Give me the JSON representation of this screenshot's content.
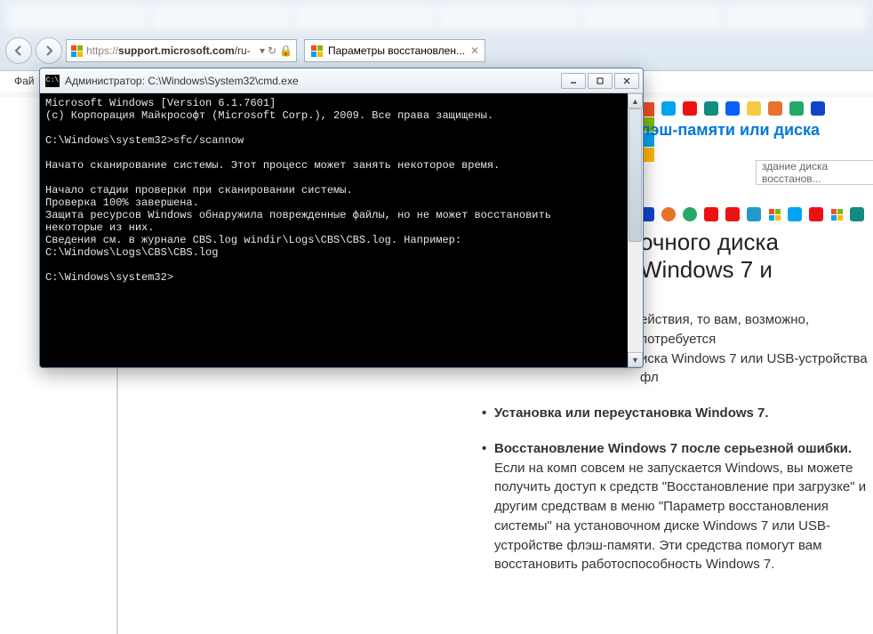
{
  "browser": {
    "url_proto": "https://",
    "url_host": "support.microsoft.com",
    "url_path": "/ru-",
    "tab_label": "Параметры восстановлен...",
    "file_menu": "Фай"
  },
  "cmd": {
    "icon_text": "C:\\",
    "title": "Администратор: C:\\Windows\\System32\\cmd.exe",
    "lines": "Microsoft Windows [Version 6.1.7601]\n(c) Корпорация Майкрософт (Microsoft Corp.), 2009. Все права защищены.\n\nC:\\Windows\\system32>sfc/scannow\n\nНачато сканирование системы. Этот процесс может занять некоторое время.\n\nНачало стадии проверки при сканировании системы.\nПроверка 100% завершена.\nЗащита ресурсов Windows обнаружила поврежденные файлы, но не может восстановить\nнекоторые из них.\nСведения см. в журнале CBS.log windir\\Logs\\CBS\\CBS.log. Например:\nC:\\Windows\\Logs\\CBS\\CBS.log\n\nC:\\Windows\\system32>"
  },
  "page": {
    "blue_heading_fragment": "лэш-памяти или диска",
    "search_placeholder": "здание диска восстанов...",
    "title_fragment_1": "очного диска ",
    "title_win": "Windows 7 и",
    "para1_fragment": "ействия, то вам, возможно, потребуется\nиска Windows 7 или USB-устройства фл",
    "bullets": [
      {
        "bold": "Установка или переустановка Windows 7.",
        "rest": ""
      },
      {
        "bold": "Восстановление Windows 7 после серьезной ошибки.",
        "rest": " Если на комп совсем не запускается Windows, вы можете получить доступ к средств \"Восстановление при загрузке\" и другим средствам в меню \"Параметр восстановления системы\" на установочном диске Windows 7 или USB-устройстве флэш-памяти. Эти средства помогут вам восстановить работоспособность Windows 7."
      }
    ]
  },
  "icons_row1": [
    "#f25022",
    "#00a4ef",
    "#00a4ef",
    "#f7c948",
    "#128c7e",
    "#0b5fff",
    "#e11",
    "#5a3",
    "#444"
  ],
  "icons_row2": [
    "#0b5",
    "#e42",
    "#e8c",
    "#e11",
    "#e11",
    "#29c",
    "#0a4",
    "#00a4ef",
    "#f7c948",
    "#128c7e"
  ]
}
